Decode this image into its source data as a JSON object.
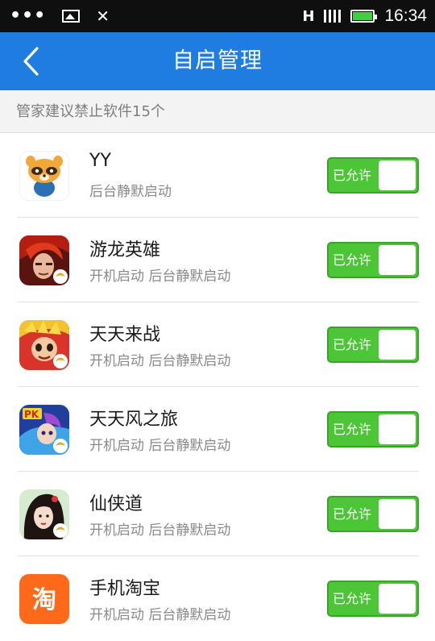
{
  "status_bar": {
    "dots": "•••",
    "close_glyph": "✕",
    "time": "16:34"
  },
  "header": {
    "title": "自启管理"
  },
  "notice": "管家建议禁止软件15个",
  "apps": [
    {
      "name": "YY",
      "desc": "后台静默启动",
      "toggle": "已允许",
      "icon": "yy-raccoon-icon"
    },
    {
      "name": "游龙英雄",
      "desc": "开机启动 后台静默启动",
      "toggle": "已允许",
      "icon": "youlong-hero-icon"
    },
    {
      "name": "天天来战",
      "desc": "开机启动 后台静默启动",
      "toggle": "已允许",
      "icon": "tiantian-laizhan-icon"
    },
    {
      "name": "天天风之旅",
      "desc": "开机启动 后台静默启动",
      "toggle": "已允许",
      "icon": "tiantian-fengzhilv-icon"
    },
    {
      "name": "仙侠道",
      "desc": "开机启动 后台静默启动",
      "toggle": "已允许",
      "icon": "xianxiadao-icon"
    },
    {
      "name": "手机淘宝",
      "desc": "开机启动 后台静默启动",
      "toggle": "已允许",
      "icon": "taobao-icon",
      "icon_text": "淘"
    }
  ],
  "colors": {
    "header": "#1f7de1",
    "toggle_on": "#4cc637",
    "notice_bg": "#f3f3f3"
  }
}
